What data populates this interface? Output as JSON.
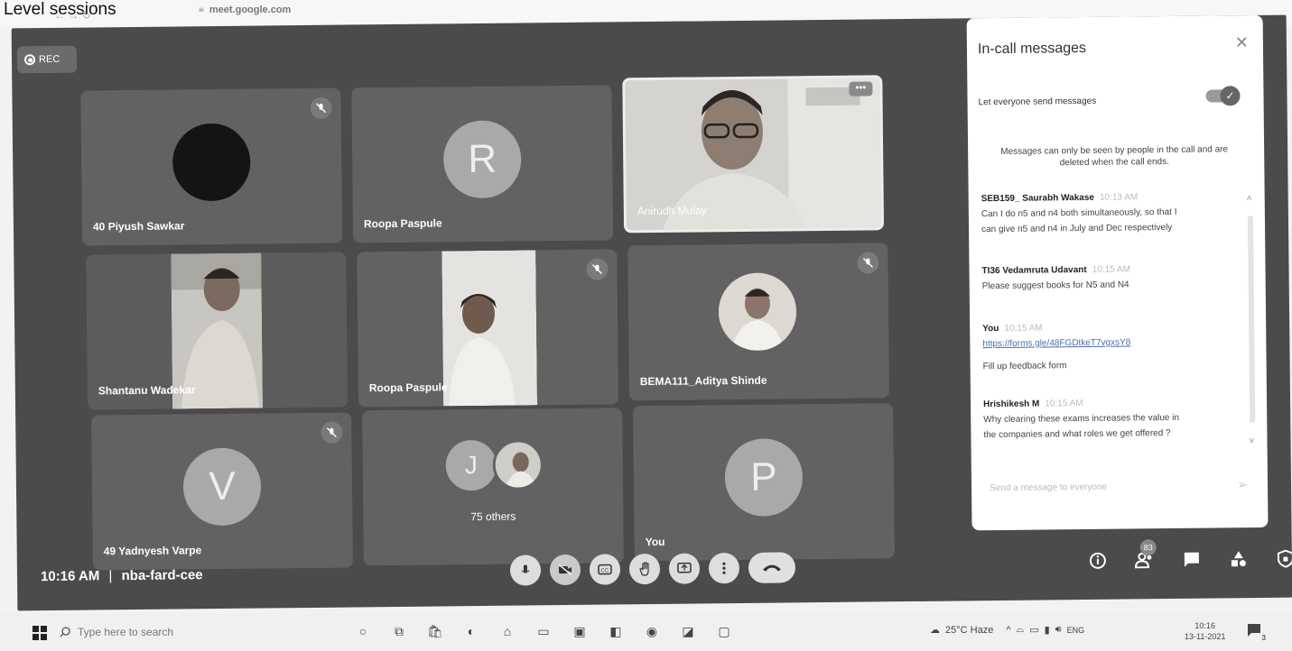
{
  "photo_caption": "Level  sessions",
  "browser": {
    "url_domain": "meet.google.com"
  },
  "meet": {
    "rec_label": "REC",
    "time": "10:16 AM",
    "meeting_code": "nba-fard-cee",
    "tiles": [
      {
        "name": "40 Piyush Sawkar",
        "type": "dark-avatar",
        "muted": true
      },
      {
        "name": "Roopa Paspule",
        "type": "letter",
        "letter": "R",
        "muted": false
      },
      {
        "name": "Anirudh Mulay",
        "type": "video",
        "muted": false
      },
      {
        "name": "Shantanu Wadekar",
        "type": "video",
        "muted": false
      },
      {
        "name": "Roopa Paspule",
        "type": "video",
        "muted": true
      },
      {
        "name": "BEMA111_Aditya Shinde",
        "type": "photo-avatar",
        "muted": true
      },
      {
        "name": "49 Yadnyesh Varpe",
        "type": "letter",
        "letter": "V",
        "muted": true
      },
      {
        "name": "75 others",
        "type": "group",
        "letter": "J",
        "muted": false
      },
      {
        "name": "You",
        "type": "letter",
        "letter": "P",
        "muted": false
      }
    ],
    "people_count": "83"
  },
  "chat": {
    "title": "In-call messages",
    "toggle_label": "Let everyone send messages",
    "note": "Messages can only be seen by people in the call and are deleted when the call ends.",
    "messages": [
      {
        "sender": "SEB159_ Saurabh Wakase",
        "time": "10:13 AM",
        "lines": [
          "Can I do n5 and n4 both simultaneously, so that I",
          "can give n5 and n4 in July and Dec respectively"
        ]
      },
      {
        "sender": "TI36 Vedamruta Udavant",
        "time": "10:15 AM",
        "lines": [
          "Please suggest books for N5 and N4"
        ]
      },
      {
        "sender": "You",
        "time": "10:15 AM",
        "link": "https://forms.gle/48FGDtkeT7vgxsY8",
        "lines": [
          "Fill up feedback form"
        ]
      },
      {
        "sender": "Hrishikesh M",
        "time": "10:15 AM",
        "lines": [
          "Why clearing these exams increases the value in",
          "the companies and what roles we get offered ?"
        ]
      }
    ],
    "input_placeholder": "Send a message to everyone"
  },
  "taskbar": {
    "search_placeholder": "Type here to search",
    "weather": "25°C  Haze",
    "language": "ENG",
    "clock_time": "10:16",
    "clock_date": "13-11-2021",
    "notification_count": "3"
  },
  "colors": {
    "meet_bg": "#4b4b4b",
    "tile_bg": "#626262",
    "panel_bg": "#ffffff",
    "link": "#4a6ea9"
  }
}
